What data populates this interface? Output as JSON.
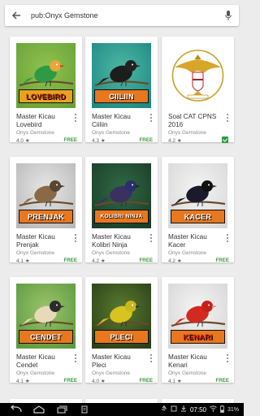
{
  "search": {
    "query": "pub:Onyx Gemstone"
  },
  "apps": [
    {
      "title": "Master Kicau Lovebird",
      "developer": "Onyx Gemstone",
      "rating": "4.0 ★",
      "price": "FREE",
      "banner": "LOVEBIRD",
      "art": "lovebird"
    },
    {
      "title": "Master Kicau Ciiliin",
      "developer": "Onyx Gemstone",
      "rating": "4.3 ★",
      "price": "FREE",
      "banner": "CIILIIN",
      "art": "ciiliin"
    },
    {
      "title": "Soal CAT CPNS 2016",
      "developer": "Onyx Gemstone",
      "rating": "4.2 ★",
      "price": "",
      "installed": true,
      "banner": "",
      "art": "garuda"
    },
    {
      "title": "Master Kicau Prenjak",
      "developer": "Onyx Gemstone",
      "rating": "4.1 ★",
      "price": "FREE",
      "banner": "PRENJAK",
      "art": "prenjak"
    },
    {
      "title": "Master Kicau Kolibri Ninja",
      "developer": "Onyx Gemstone",
      "rating": "4.2 ★",
      "price": "FREE",
      "banner": "KOLIBRI NINJA",
      "art": "kolibri"
    },
    {
      "title": "Master Kicau Kacer",
      "developer": "Onyx Gemstone",
      "rating": "4.2 ★",
      "price": "FREE",
      "banner": "KACER",
      "art": "kacer"
    },
    {
      "title": "Master Kicau Cendet",
      "developer": "Onyx Gemstone",
      "rating": "4.1 ★",
      "price": "FREE",
      "banner": "CENDET",
      "art": "cendet"
    },
    {
      "title": "Master Kicau Pleci",
      "developer": "Onyx Gemstone",
      "rating": "4.0 ★",
      "price": "FREE",
      "banner": "PLECI",
      "art": "pleci"
    },
    {
      "title": "Master Kicau Kenari",
      "developer": "Onyx Gemstone",
      "rating": "4.1 ★",
      "price": "FREE",
      "banner": "KENARI",
      "art": "kenari"
    }
  ],
  "status": {
    "time": "07:50",
    "battery": "31%"
  },
  "colors": {
    "accent_green": "#3a9a3a",
    "banner_orange": "#e8771e",
    "navbar": "#000000"
  }
}
